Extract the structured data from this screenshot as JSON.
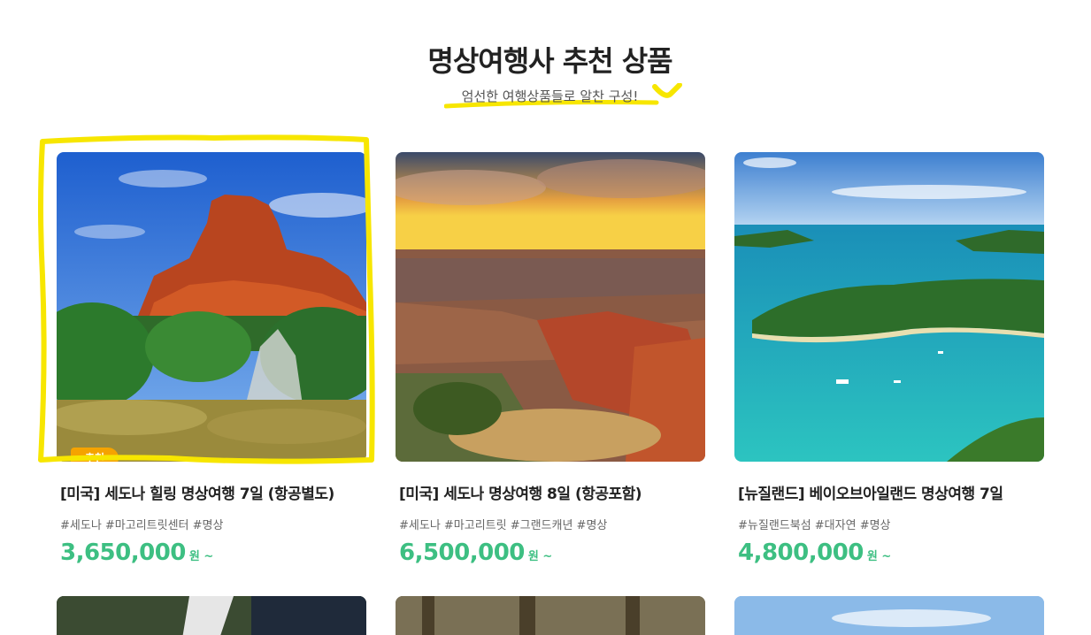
{
  "section": {
    "title": "명상여행사 추천 상품",
    "subtitle": "엄선한 여행상품들로 알찬 구성!"
  },
  "colors": {
    "accent_green": "#3dbf82",
    "badge_orange": "#f5a300",
    "marker_yellow": "#f7e600"
  },
  "products": [
    {
      "badge": "추천",
      "title": "[미국] 세도나 힐링 명상여행 7일 (항공별도)",
      "tags": "#세도나 #마고리트릿센터 #명상",
      "price": "3,650,000",
      "unit": "원 ~",
      "image": "sedona-red-rock"
    },
    {
      "title": "[미국] 세도나 명상여행 8일 (항공포함)",
      "tags": "#세도나 #마고리트릿 #그랜드캐년 #명상",
      "price": "6,500,000",
      "unit": "원 ~",
      "image": "grand-canyon-sunset"
    },
    {
      "title": "[뉴질랜드] 베이오브아일랜드 명상여행 7일",
      "tags": "#뉴질랜드북섬 #대자연 #명상",
      "price": "4,800,000",
      "unit": "원 ~",
      "image": "bay-of-islands"
    }
  ]
}
